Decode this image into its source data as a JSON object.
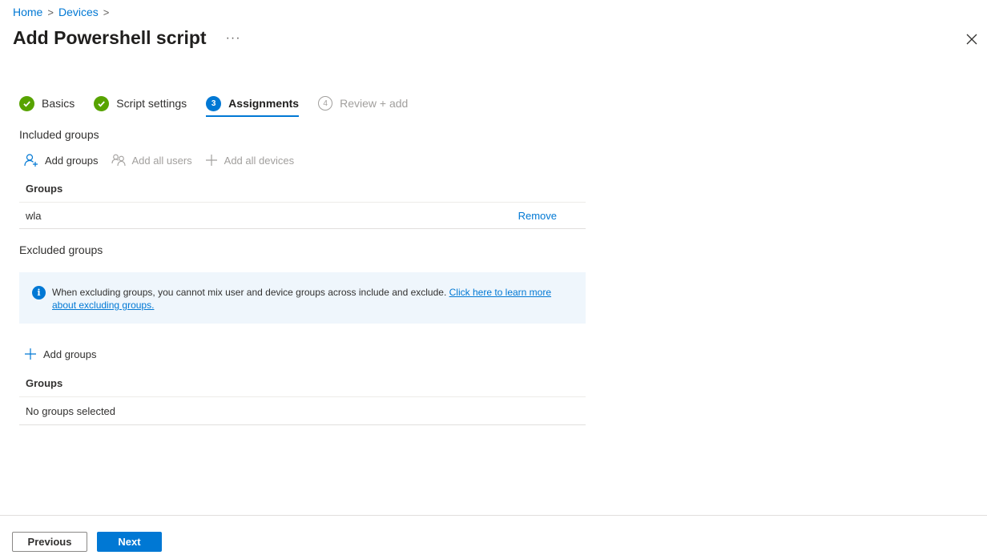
{
  "breadcrumb": {
    "items": [
      {
        "label": "Home"
      },
      {
        "label": "Devices"
      }
    ],
    "separator": ">"
  },
  "page": {
    "title": "Add Powershell script",
    "more_label": "···"
  },
  "wizard": {
    "steps": [
      {
        "label": "Basics",
        "state": "completed"
      },
      {
        "label": "Script settings",
        "state": "completed"
      },
      {
        "label": "Assignments",
        "number": "3",
        "state": "current"
      },
      {
        "label": "Review + add",
        "number": "4",
        "state": "upcoming"
      }
    ]
  },
  "included": {
    "section_label": "Included groups",
    "commands": {
      "add_groups": "Add groups",
      "add_all_users": "Add all users",
      "add_all_devices": "Add all devices"
    },
    "column_header": "Groups",
    "rows": [
      {
        "name": "wla",
        "action": "Remove"
      }
    ]
  },
  "excluded": {
    "section_label": "Excluded groups",
    "info": {
      "text": "When excluding groups, you cannot mix user and device groups across include and exclude.",
      "link_text": "Click here to learn more about excluding groups."
    },
    "add_groups": "Add groups",
    "column_header": "Groups",
    "empty_text": "No groups selected"
  },
  "footer": {
    "previous_label": "Previous",
    "next_label": "Next"
  },
  "colors": {
    "accent": "#0078d4",
    "success": "#57a300",
    "info_bg": "#eff6fc"
  }
}
